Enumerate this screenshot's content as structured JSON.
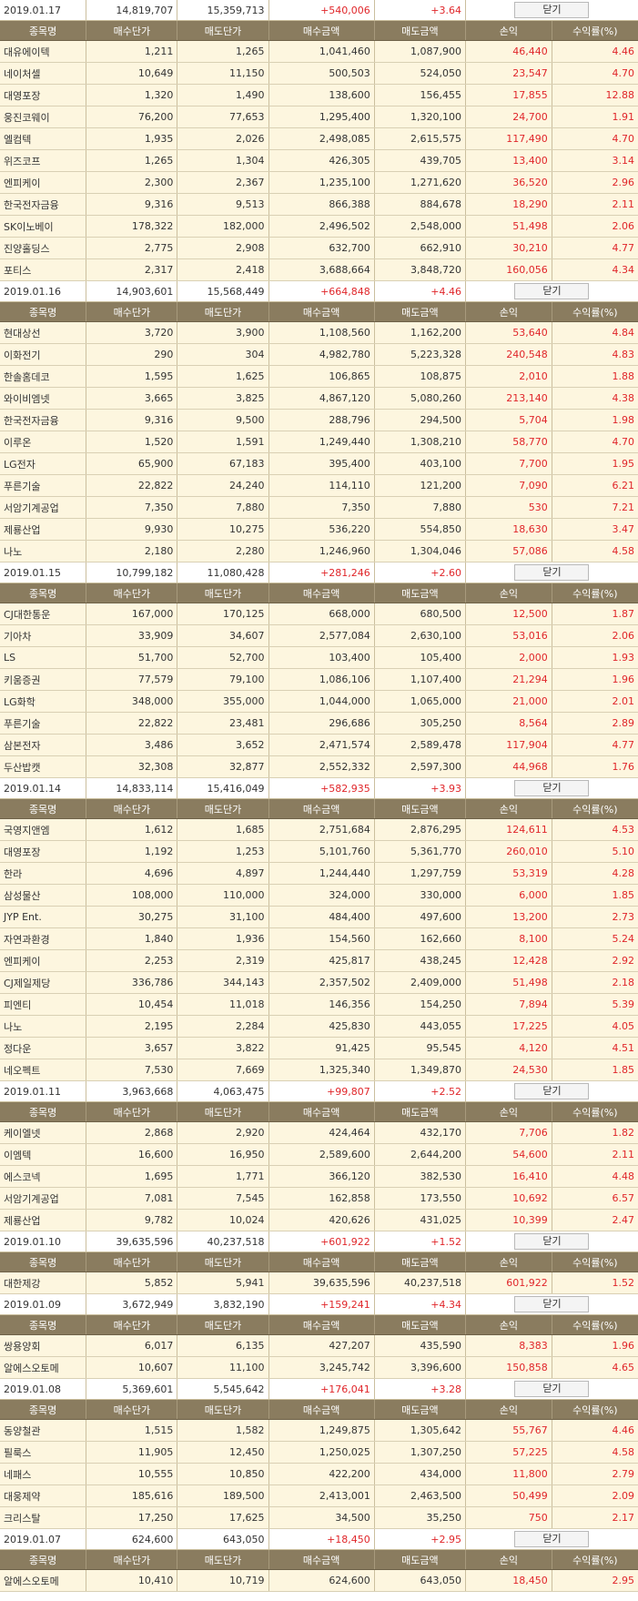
{
  "columns": [
    "종목명",
    "매수단가",
    "매도단가",
    "매수금액",
    "매도금액",
    "손익",
    "수익률(%)"
  ],
  "close_label": "닫기",
  "groups": [
    {
      "date": "2019.01.17",
      "buy_total": "14,819,707",
      "sell_total": "15,359,713",
      "profit": "+540,006",
      "rate": "+3.64",
      "rows": [
        [
          "대유에이텍",
          "1,211",
          "1,265",
          "1,041,460",
          "1,087,900",
          "46,440",
          "4.46"
        ],
        [
          "네이처셀",
          "10,649",
          "11,150",
          "500,503",
          "524,050",
          "23,547",
          "4.70"
        ],
        [
          "대영포장",
          "1,320",
          "1,490",
          "138,600",
          "156,455",
          "17,855",
          "12.88"
        ],
        [
          "웅진코웨이",
          "76,200",
          "77,653",
          "1,295,400",
          "1,320,100",
          "24,700",
          "1.91"
        ],
        [
          "엘컴텍",
          "1,935",
          "2,026",
          "2,498,085",
          "2,615,575",
          "117,490",
          "4.70"
        ],
        [
          "위즈코프",
          "1,265",
          "1,304",
          "426,305",
          "439,705",
          "13,400",
          "3.14"
        ],
        [
          "엔피케이",
          "2,300",
          "2,367",
          "1,235,100",
          "1,271,620",
          "36,520",
          "2.96"
        ],
        [
          "한국전자금융",
          "9,316",
          "9,513",
          "866,388",
          "884,678",
          "18,290",
          "2.11"
        ],
        [
          "SK이노베이",
          "178,322",
          "182,000",
          "2,496,502",
          "2,548,000",
          "51,498",
          "2.06"
        ],
        [
          "진양홀딩스",
          "2,775",
          "2,908",
          "632,700",
          "662,910",
          "30,210",
          "4.77"
        ],
        [
          "포티스",
          "2,317",
          "2,418",
          "3,688,664",
          "3,848,720",
          "160,056",
          "4.34"
        ]
      ]
    },
    {
      "date": "2019.01.16",
      "buy_total": "14,903,601",
      "sell_total": "15,568,449",
      "profit": "+664,848",
      "rate": "+4.46",
      "rows": [
        [
          "현대상선",
          "3,720",
          "3,900",
          "1,108,560",
          "1,162,200",
          "53,640",
          "4.84"
        ],
        [
          "이화전기",
          "290",
          "304",
          "4,982,780",
          "5,223,328",
          "240,548",
          "4.83"
        ],
        [
          "한솔홈데코",
          "1,595",
          "1,625",
          "106,865",
          "108,875",
          "2,010",
          "1.88"
        ],
        [
          "와이비엠넷",
          "3,665",
          "3,825",
          "4,867,120",
          "5,080,260",
          "213,140",
          "4.38"
        ],
        [
          "한국전자금융",
          "9,316",
          "9,500",
          "288,796",
          "294,500",
          "5,704",
          "1.98"
        ],
        [
          "이루온",
          "1,520",
          "1,591",
          "1,249,440",
          "1,308,210",
          "58,770",
          "4.70"
        ],
        [
          "LG전자",
          "65,900",
          "67,183",
          "395,400",
          "403,100",
          "7,700",
          "1.95"
        ],
        [
          "푸른기술",
          "22,822",
          "24,240",
          "114,110",
          "121,200",
          "7,090",
          "6.21"
        ],
        [
          "서암기계공업",
          "7,350",
          "7,880",
          "7,350",
          "7,880",
          "530",
          "7.21"
        ],
        [
          "제룡산업",
          "9,930",
          "10,275",
          "536,220",
          "554,850",
          "18,630",
          "3.47"
        ],
        [
          "나노",
          "2,180",
          "2,280",
          "1,246,960",
          "1,304,046",
          "57,086",
          "4.58"
        ]
      ]
    },
    {
      "date": "2019.01.15",
      "buy_total": "10,799,182",
      "sell_total": "11,080,428",
      "profit": "+281,246",
      "rate": "+2.60",
      "rows": [
        [
          "CJ대한통운",
          "167,000",
          "170,125",
          "668,000",
          "680,500",
          "12,500",
          "1.87"
        ],
        [
          "기아차",
          "33,909",
          "34,607",
          "2,577,084",
          "2,630,100",
          "53,016",
          "2.06"
        ],
        [
          "LS",
          "51,700",
          "52,700",
          "103,400",
          "105,400",
          "2,000",
          "1.93"
        ],
        [
          "키움증권",
          "77,579",
          "79,100",
          "1,086,106",
          "1,107,400",
          "21,294",
          "1.96"
        ],
        [
          "LG화학",
          "348,000",
          "355,000",
          "1,044,000",
          "1,065,000",
          "21,000",
          "2.01"
        ],
        [
          "푸른기술",
          "22,822",
          "23,481",
          "296,686",
          "305,250",
          "8,564",
          "2.89"
        ],
        [
          "삼본전자",
          "3,486",
          "3,652",
          "2,471,574",
          "2,589,478",
          "117,904",
          "4.77"
        ],
        [
          "두산밥캣",
          "32,308",
          "32,877",
          "2,552,332",
          "2,597,300",
          "44,968",
          "1.76"
        ]
      ]
    },
    {
      "date": "2019.01.14",
      "buy_total": "14,833,114",
      "sell_total": "15,416,049",
      "profit": "+582,935",
      "rate": "+3.93",
      "rows": [
        [
          "국영지앤엠",
          "1,612",
          "1,685",
          "2,751,684",
          "2,876,295",
          "124,611",
          "4.53"
        ],
        [
          "대영포장",
          "1,192",
          "1,253",
          "5,101,760",
          "5,361,770",
          "260,010",
          "5.10"
        ],
        [
          "한라",
          "4,696",
          "4,897",
          "1,244,440",
          "1,297,759",
          "53,319",
          "4.28"
        ],
        [
          "삼성물산",
          "108,000",
          "110,000",
          "324,000",
          "330,000",
          "6,000",
          "1.85"
        ],
        [
          "JYP Ent.",
          "30,275",
          "31,100",
          "484,400",
          "497,600",
          "13,200",
          "2.73"
        ],
        [
          "자연과환경",
          "1,840",
          "1,936",
          "154,560",
          "162,660",
          "8,100",
          "5.24"
        ],
        [
          "엔피케이",
          "2,253",
          "2,319",
          "425,817",
          "438,245",
          "12,428",
          "2.92"
        ],
        [
          "CJ제일제당",
          "336,786",
          "344,143",
          "2,357,502",
          "2,409,000",
          "51,498",
          "2.18"
        ],
        [
          "피엔티",
          "10,454",
          "11,018",
          "146,356",
          "154,250",
          "7,894",
          "5.39"
        ],
        [
          "나노",
          "2,195",
          "2,284",
          "425,830",
          "443,055",
          "17,225",
          "4.05"
        ],
        [
          "정다운",
          "3,657",
          "3,822",
          "91,425",
          "95,545",
          "4,120",
          "4.51"
        ],
        [
          "네오펙트",
          "7,530",
          "7,669",
          "1,325,340",
          "1,349,870",
          "24,530",
          "1.85"
        ]
      ]
    },
    {
      "date": "2019.01.11",
      "buy_total": "3,963,668",
      "sell_total": "4,063,475",
      "profit": "+99,807",
      "rate": "+2.52",
      "rows": [
        [
          "케이엘넷",
          "2,868",
          "2,920",
          "424,464",
          "432,170",
          "7,706",
          "1.82"
        ],
        [
          "이엠텍",
          "16,600",
          "16,950",
          "2,589,600",
          "2,644,200",
          "54,600",
          "2.11"
        ],
        [
          "에스코넥",
          "1,695",
          "1,771",
          "366,120",
          "382,530",
          "16,410",
          "4.48"
        ],
        [
          "서암기계공업",
          "7,081",
          "7,545",
          "162,858",
          "173,550",
          "10,692",
          "6.57"
        ],
        [
          "제룡산업",
          "9,782",
          "10,024",
          "420,626",
          "431,025",
          "10,399",
          "2.47"
        ]
      ]
    },
    {
      "date": "2019.01.10",
      "buy_total": "39,635,596",
      "sell_total": "40,237,518",
      "profit": "+601,922",
      "rate": "+1.52",
      "rows": [
        [
          "대한제강",
          "5,852",
          "5,941",
          "39,635,596",
          "40,237,518",
          "601,922",
          "1.52"
        ]
      ]
    },
    {
      "date": "2019.01.09",
      "buy_total": "3,672,949",
      "sell_total": "3,832,190",
      "profit": "+159,241",
      "rate": "+4.34",
      "rows": [
        [
          "쌍용양회",
          "6,017",
          "6,135",
          "427,207",
          "435,590",
          "8,383",
          "1.96"
        ],
        [
          "알에스오토메",
          "10,607",
          "11,100",
          "3,245,742",
          "3,396,600",
          "150,858",
          "4.65"
        ]
      ]
    },
    {
      "date": "2019.01.08",
      "buy_total": "5,369,601",
      "sell_total": "5,545,642",
      "profit": "+176,041",
      "rate": "+3.28",
      "rows": [
        [
          "동양철관",
          "1,515",
          "1,582",
          "1,249,875",
          "1,305,642",
          "55,767",
          "4.46"
        ],
        [
          "필룩스",
          "11,905",
          "12,450",
          "1,250,025",
          "1,307,250",
          "57,225",
          "4.58"
        ],
        [
          "네패스",
          "10,555",
          "10,850",
          "422,200",
          "434,000",
          "11,800",
          "2.79"
        ],
        [
          "대웅제약",
          "185,616",
          "189,500",
          "2,413,001",
          "2,463,500",
          "50,499",
          "2.09"
        ],
        [
          "크리스탈",
          "17,250",
          "17,625",
          "34,500",
          "35,250",
          "750",
          "2.17"
        ]
      ]
    },
    {
      "date": "2019.01.07",
      "buy_total": "624,600",
      "sell_total": "643,050",
      "profit": "+18,450",
      "rate": "+2.95",
      "rows": [
        [
          "알에스오토메",
          "10,410",
          "10,719",
          "624,600",
          "643,050",
          "18,450",
          "2.95"
        ]
      ]
    }
  ]
}
